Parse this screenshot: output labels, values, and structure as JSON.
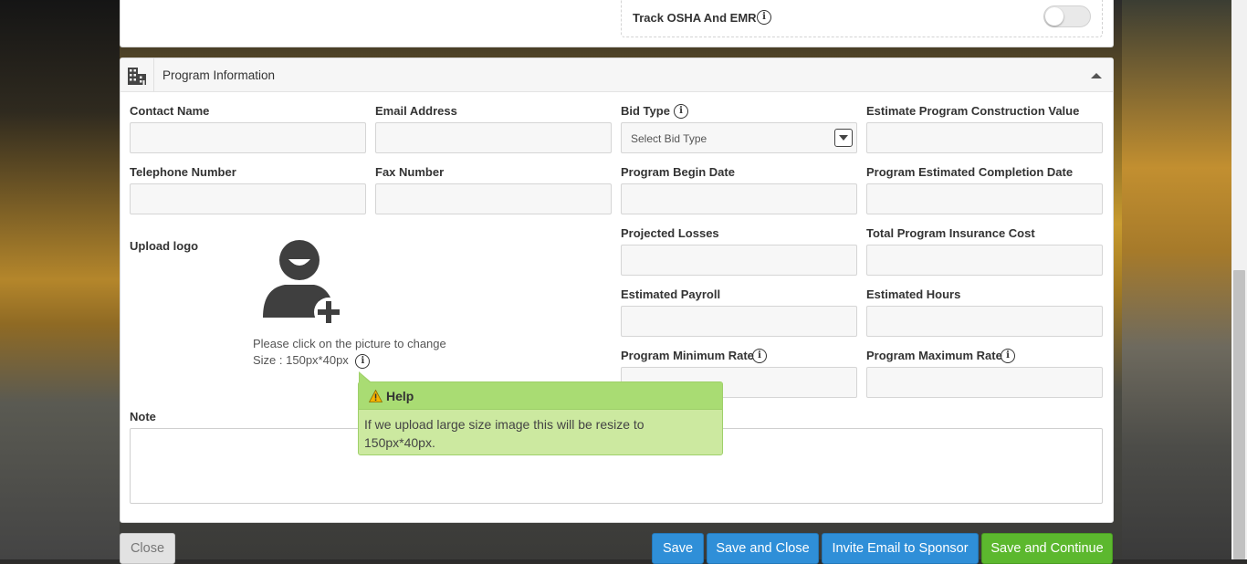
{
  "osha": {
    "label": "Track OSHA And EMR",
    "info_icon": "info-icon",
    "toggle_on": false
  },
  "panel": {
    "title": "Program Information",
    "icon": "building-icon",
    "collapse_icon": "caret-up-icon"
  },
  "fields": {
    "contact_name": {
      "label": "Contact Name",
      "value": ""
    },
    "email_address": {
      "label": "Email Address",
      "value": ""
    },
    "bid_type": {
      "label": "Bid Type",
      "selected": "Select Bid Type"
    },
    "estimate_value": {
      "label": "Estimate Program Construction Value",
      "value": ""
    },
    "telephone": {
      "label": "Telephone Number",
      "value": ""
    },
    "fax": {
      "label": "Fax Number",
      "value": ""
    },
    "begin_date": {
      "label": "Program Begin Date",
      "value": ""
    },
    "completion_date": {
      "label": "Program Estimated Completion Date",
      "value": ""
    },
    "projected_losses": {
      "label": "Projected Losses",
      "value": ""
    },
    "insurance_cost": {
      "label": "Total Program Insurance Cost",
      "value": ""
    },
    "estimated_payroll": {
      "label": "Estimated Payroll",
      "value": ""
    },
    "estimated_hours": {
      "label": "Estimated Hours",
      "value": ""
    },
    "min_rate": {
      "label": "Program Minimum Rate",
      "value": ""
    },
    "max_rate": {
      "label": "Program Maximum Rate",
      "value": ""
    },
    "note": {
      "label": "Note",
      "value": ""
    }
  },
  "upload": {
    "label": "Upload logo",
    "hint": "Please click on the picture to change",
    "size": "Size : 150px*40px",
    "icon": "add-user-icon"
  },
  "help": {
    "title": "Help",
    "text": "If we upload large size image this will be resize to 150px*40px.",
    "icon": "warning-icon"
  },
  "buttons": {
    "close": "Close",
    "save": "Save",
    "save_and_close": "Save and Close",
    "invite": "Invite Email to Sponsor",
    "save_and_continue": "Save and Continue"
  },
  "colors": {
    "blue": "#2f8fd8",
    "green": "#5cb82e",
    "help_bg": "#cce9a0"
  }
}
